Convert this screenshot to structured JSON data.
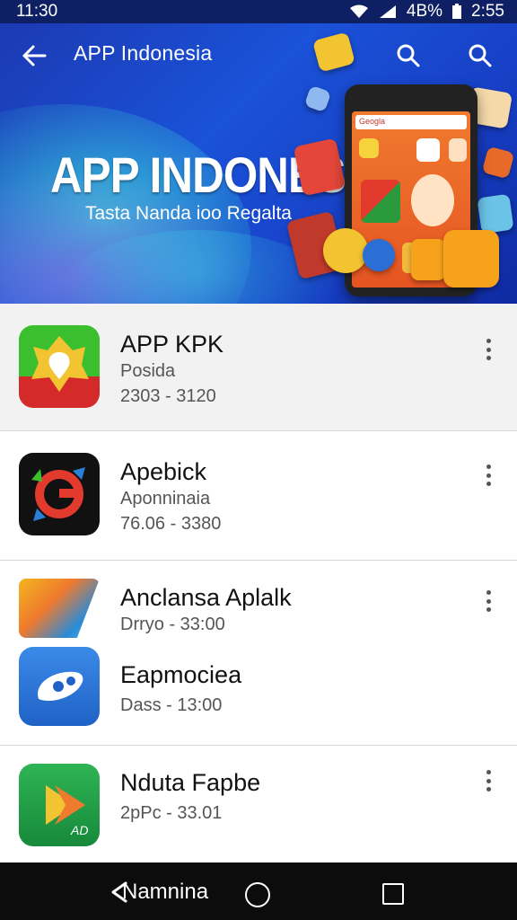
{
  "status_bar": {
    "time_left": "11:30",
    "network": "4B%",
    "time_right": "2:55"
  },
  "app_bar": {
    "title": "APP Indonesia",
    "back_icon": "arrow-left-icon",
    "search_icon": "search-icon"
  },
  "banner": {
    "headline": "APP INDONESIA",
    "subtitle": "Tasta Nanda ioo Regalta",
    "phone_url": "Geogla"
  },
  "apps": [
    {
      "name": "APP KPK",
      "subtitle": "Posida",
      "meta": "2303 - 3120",
      "icon": "map-pin-icon"
    },
    {
      "name": "Apebick",
      "subtitle": "Aponninaia",
      "meta": "76.06 - 3380",
      "icon": "g-refresh-icon"
    },
    {
      "name": "Anclansa Aplalk",
      "subtitle": "",
      "meta": "Drryo - 33:00",
      "icon": "hd-tag-icon"
    },
    {
      "name": "Eapmociea",
      "subtitle": "",
      "meta": "Dass - 13:00",
      "icon": "link-icon"
    },
    {
      "name": "Nduta Fapbe",
      "subtitle": "",
      "meta": "2pPc - 33.01",
      "icon": "play-arrow-icon",
      "icon_label": "AD"
    }
  ],
  "nav_bar": {
    "back_label": "Namnina",
    "home_icon": "home-circle-icon",
    "recents_icon": "recents-square-icon"
  },
  "colors": {
    "banner_blue": "#1a52d8",
    "status_bar": "#0e1f63",
    "nav_bar": "#0c0c0c",
    "list_highlight": "#f2f2f2"
  }
}
